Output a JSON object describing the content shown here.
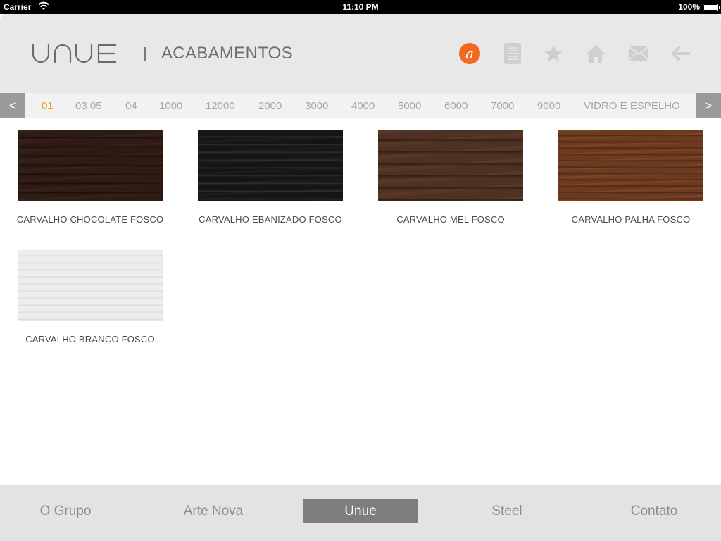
{
  "status_bar": {
    "carrier": "Carrier",
    "time": "11:10 PM",
    "battery": "100%"
  },
  "header": {
    "brand": "UNUE",
    "title": "ACABAMENTOS",
    "badge_letter": "a",
    "icons": [
      "a-badge-icon",
      "document-icon",
      "star-icon",
      "home-icon",
      "mail-icon",
      "back-arrow-icon"
    ]
  },
  "category_nav": {
    "prev_label": "<",
    "next_label": ">",
    "items": [
      "01",
      "03 05",
      "04",
      "1000",
      "12000",
      "2000",
      "3000",
      "4000",
      "5000",
      "6000",
      "7000",
      "9000",
      "VIDRO E ESPELHO"
    ],
    "active_index": 0
  },
  "finishes": [
    {
      "name": "CARVALHO CHOCOLATE FOSCO",
      "color": "#2e1b14"
    },
    {
      "name": "CARVALHO EBANIZADO FOSCO",
      "color": "#151515"
    },
    {
      "name": "CARVALHO MEL FOSCO",
      "color": "#4f3123"
    },
    {
      "name": "CARVALHO PALHA FOSCO",
      "color": "#6c3a1f"
    },
    {
      "name": "CARVALHO BRANCO FOSCO",
      "color": "#ededed"
    }
  ],
  "tabs": {
    "items": [
      "O Grupo",
      "Arte Nova",
      "Unue",
      "Steel",
      "Contato"
    ],
    "active_index": 2
  },
  "colors": {
    "accent_orange": "#f26a21",
    "active_category": "#f7941d",
    "active_tab": "#7e7e7e"
  }
}
